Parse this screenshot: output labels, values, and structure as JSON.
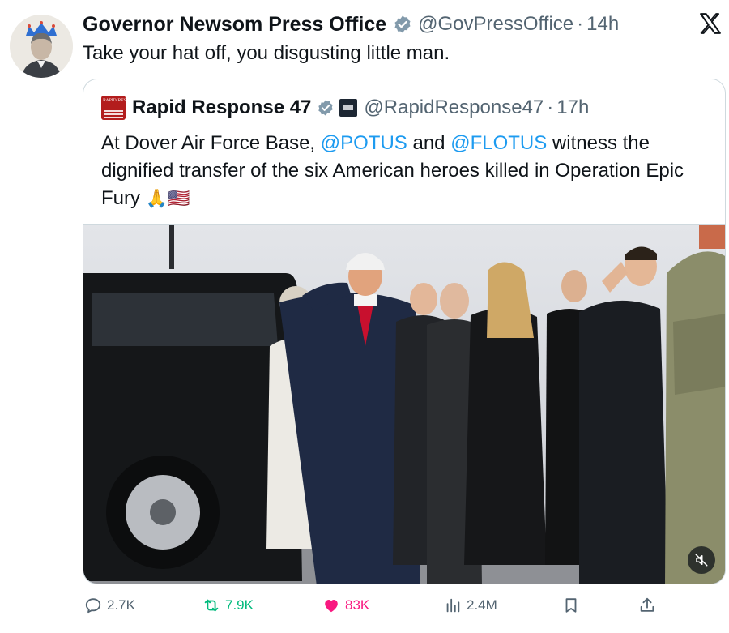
{
  "tweet": {
    "author_name": "Governor Newsom Press Office",
    "handle": "@GovPressOffice",
    "separator": "·",
    "time": "14h",
    "text": "Take your hat off, you disgusting little man."
  },
  "quote": {
    "author_name": "Rapid Response 47",
    "handle": "@RapidResponse47",
    "separator": "·",
    "time": "17h",
    "text_parts": {
      "p1": "At Dover Air Force Base, ",
      "m1": "@POTUS",
      "p2": " and ",
      "m2": "@FLOTUS",
      "p3": " witness the dignified transfer of the six American heroes killed in Operation Epic Fury ",
      "emoji": "🙏🇺🇸"
    },
    "avatar_lines": "RAPID RESPONSE"
  },
  "media": {
    "icon": "muted-speaker-icon"
  },
  "actions": {
    "replies": "2.7K",
    "reposts": "7.9K",
    "likes": "83K",
    "views": "2.4M"
  },
  "colors": {
    "accent_link": "#1d9bf0",
    "like": "#f91880",
    "repost": "#00ba7c",
    "secondary_text": "#536471",
    "verified": "#829aab"
  },
  "icons": [
    "verified-badge-icon",
    "x-logo-icon",
    "reply-icon",
    "repost-icon",
    "like-heart-icon",
    "views-icon",
    "bookmark-icon",
    "share-icon"
  ]
}
